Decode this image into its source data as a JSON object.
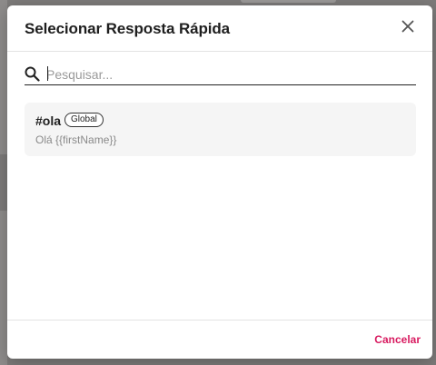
{
  "dialog": {
    "title": "Selecionar Resposta Rápida",
    "close_icon": "close-icon"
  },
  "search": {
    "placeholder": "Pesquisar...",
    "value": "",
    "icon": "search-icon"
  },
  "replies": [
    {
      "shortcut": "#ola",
      "scope": "Global",
      "message": "Olá {{firstName}}"
    }
  ],
  "footer": {
    "cancel_label": "Cancelar"
  },
  "colors": {
    "accent": "#d81b60",
    "overlay": "#7d7b7a",
    "card_bg": "#f5f5f5"
  }
}
